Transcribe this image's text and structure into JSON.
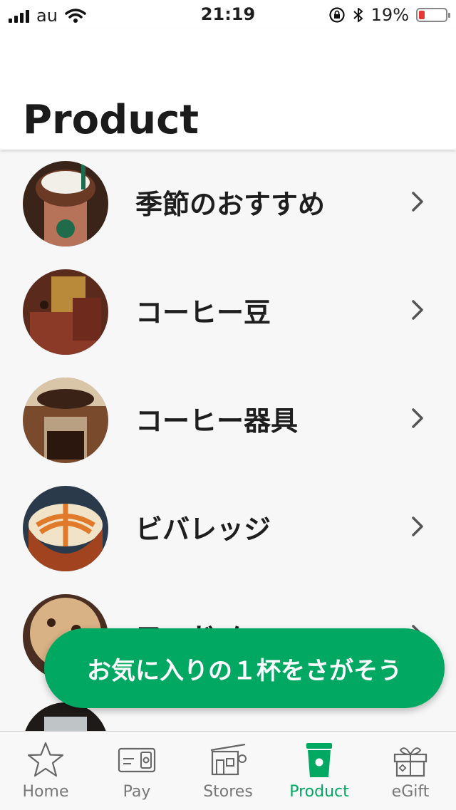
{
  "status_bar": {
    "carrier": "au",
    "time": "21:19",
    "battery": "19%",
    "battery_level": 0.19
  },
  "header": {
    "title": "Product"
  },
  "list": {
    "items": [
      {
        "label": "季節のおすすめ",
        "thumb": "frappuccino-photo"
      },
      {
        "label": "コーヒー豆",
        "thumb": "coffee-beans-photo"
      },
      {
        "label": "コーヒー器具",
        "thumb": "coffee-dripper-photo"
      },
      {
        "label": "ビバレッジ",
        "thumb": "latte-photo"
      },
      {
        "label": "フードメニュー",
        "thumb": "cookie-photo"
      },
      {
        "label": "",
        "thumb": "cold-drink-photo"
      }
    ]
  },
  "cta": {
    "label": "お気に入りの１杯をさがそう"
  },
  "tabbar": {
    "tabs": [
      {
        "label": "Home",
        "icon": "star-icon"
      },
      {
        "label": "Pay",
        "icon": "pay-card-icon"
      },
      {
        "label": "Stores",
        "icon": "store-icon"
      },
      {
        "label": "Product",
        "icon": "cup-icon",
        "active": true
      },
      {
        "label": "eGift",
        "icon": "gift-icon"
      }
    ]
  },
  "colors": {
    "accent": "#00a862",
    "tab_inactive": "#777777",
    "battery_low": "#e53935"
  }
}
